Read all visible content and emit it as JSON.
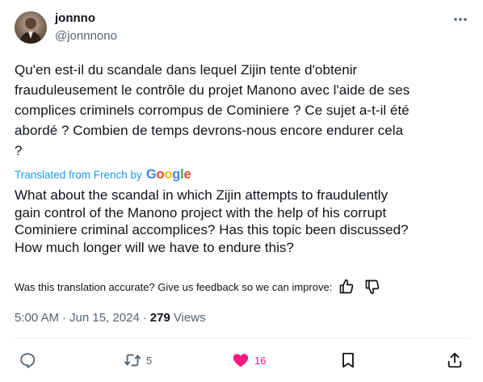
{
  "author": {
    "name": "jonnno",
    "handle": "@jonnnono"
  },
  "icons": {
    "more": "more-horizontal-icon",
    "thumbs_up": "thumbs-up-icon",
    "thumbs_down": "thumbs-down-icon",
    "reply": "reply-icon",
    "retweet": "retweet-icon",
    "like": "heart-icon",
    "bookmark": "bookmark-icon",
    "share": "share-icon"
  },
  "tweet": {
    "original_lines": [
      "Qu'en est-il du scandale dans lequel Zijin tente d'obtenir",
      "frauduleusement le contrôle du projet Manono avec l'aide de ses",
      "complices criminels corrompus de Cominiere ? Ce sujet a-t-il été",
      "abordé ? Combien de temps devrons-nous encore endurer cela",
      "?"
    ],
    "translated_from": "Translated from French by",
    "translation_provider": "Google",
    "translation_lines": [
      "What about the scandal in which Zijin attempts to fraudulently",
      "gain control of the Manono project with the help of his corrupt",
      "Cominiere criminal accomplices? Has this topic been discussed?",
      "How much longer will we have to endure this?"
    ],
    "feedback_prompt": "Was this translation accurate? Give us feedback so we can improve:"
  },
  "meta": {
    "time": "5:00 AM",
    "separator": "·",
    "date": "Jun 15, 2024",
    "views_count": "279",
    "views_label": "Views"
  },
  "actions": {
    "reply_count": "",
    "retweet_count": "5",
    "like_count": "16",
    "liked": true
  },
  "colors": {
    "text": "#0f1419",
    "secondary": "#536471",
    "link_blue": "#1d9bf0",
    "like_pink": "#f91880",
    "google_blue": "#4285F4",
    "google_red": "#EA4335",
    "google_yellow": "#FBBC05",
    "google_green": "#34A853"
  }
}
